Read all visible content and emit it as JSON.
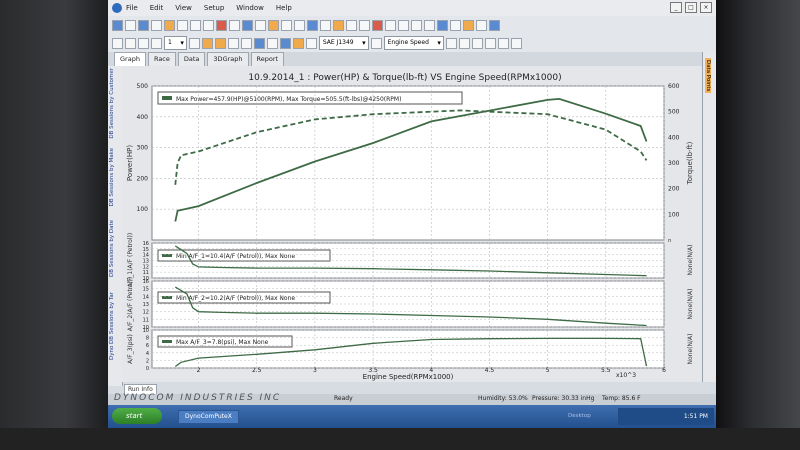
{
  "menu": {
    "items": [
      "File",
      "Edit",
      "View",
      "Setup",
      "Window",
      "Help"
    ]
  },
  "toolbar": {
    "zoom_value": "1",
    "standard": "SAE J1349",
    "xaxis": "Engine Speed"
  },
  "tabs": [
    "Graph",
    "Race",
    "Data",
    "3DGraph",
    "Report"
  ],
  "left_panel": [
    "DB Sessions by Customer",
    "DB Sessions by Make",
    "DB Sessions by Date",
    "Dyno DB Sessions by Tar"
  ],
  "right_panel": {
    "tab": "Data Points"
  },
  "chart": {
    "title": "10.9.2014_1 : Power(HP) & Torque(lb-ft) VS Engine Speed(RPMx1000)",
    "xlabel": "Engine Speed(RPMx1000)",
    "xscale_label": "x10^3",
    "xticks": [
      "2",
      "2.5",
      "3",
      "3.5",
      "4",
      "4.5",
      "5",
      "5.5",
      "6"
    ],
    "panel1": {
      "ylabel_left": "Power(HP)",
      "ylabel_right": "Torque(lb-ft)",
      "yticks_left": [
        "100",
        "200",
        "300",
        "400",
        "500"
      ],
      "yticks_right": [
        "100",
        "200",
        "300",
        "400",
        "500",
        "600"
      ],
      "legend": "Max Power=457.9(HP)@5100(RPM), Max Torque=505.5(ft-lbs)@4250(RPM)"
    },
    "panel2": {
      "ylabel_left": "A/F_1(A/F (Petrol))",
      "ylabel_right": "None(N/A)",
      "yticks_left": [
        "10",
        "11",
        "12",
        "13",
        "14",
        "15",
        "16"
      ],
      "right_tick": "n",
      "legend": "Min A/F_1=10.4(A/F (Petrol)), Max None"
    },
    "panel3": {
      "ylabel_left": "A/F_2(A/F (Petrol))",
      "ylabel_right": "None(N/A)",
      "yticks_left": [
        "10",
        "11",
        "12",
        "13",
        "14",
        "15",
        "16"
      ],
      "legend": "Min A/F_2=10.2(A/F (Petrol)), Max None"
    },
    "panel4": {
      "ylabel_left": "A/F_3(psi)",
      "ylabel_right": "None(N/A)",
      "yticks_left": [
        "0",
        "2",
        "4",
        "6",
        "8",
        "10"
      ],
      "legend": "Max A/F_3=7.8(psi), Max None"
    }
  },
  "chart_data": [
    {
      "type": "line",
      "title": "10.9.2014_1 : Power(HP) & Torque(lb-ft) VS Engine Speed(RPMx1000)",
      "xlabel": "Engine Speed(RPMx1000)",
      "ylabel": "Power(HP)",
      "ylabel_right": "Torque(lb-ft)",
      "xlim": [
        1.6,
        6
      ],
      "ylim": [
        0,
        500
      ],
      "ylim_right": [
        0,
        600
      ],
      "series": [
        {
          "name": "Power(HP)",
          "axis": "left",
          "x": [
            1.8,
            1.82,
            2,
            2.5,
            3,
            3.5,
            4,
            4.5,
            5,
            5.1,
            5.5,
            5.8,
            5.85
          ],
          "y": [
            60,
            95,
            110,
            185,
            255,
            315,
            385,
            420,
            455,
            458,
            410,
            370,
            320
          ]
        },
        {
          "name": "Torque(lb-ft)",
          "axis": "right",
          "style": "dashed",
          "x": [
            1.8,
            1.82,
            1.85,
            2,
            2.5,
            3,
            3.5,
            4,
            4.25,
            4.5,
            5,
            5.5,
            5.8,
            5.85
          ],
          "y": [
            215,
            300,
            330,
            345,
            420,
            470,
            490,
            500,
            505,
            500,
            490,
            430,
            345,
            310
          ]
        }
      ]
    },
    {
      "type": "line",
      "ylabel": "A/F_1(A/F (Petrol))",
      "xlim": [
        1.6,
        6
      ],
      "ylim": [
        10,
        16
      ],
      "series": [
        {
          "name": "A/F_1",
          "x": [
            1.8,
            1.9,
            1.95,
            2,
            2.2,
            2.5,
            3,
            3.5,
            4,
            4.5,
            5,
            5.5,
            5.85
          ],
          "y": [
            15.5,
            14.2,
            12.4,
            11.9,
            11.8,
            11.7,
            11.7,
            11.6,
            11.4,
            11.2,
            10.9,
            10.6,
            10.4
          ]
        }
      ]
    },
    {
      "type": "line",
      "ylabel": "A/F_2(A/F (Petrol))",
      "xlim": [
        1.6,
        6
      ],
      "ylim": [
        10,
        16
      ],
      "series": [
        {
          "name": "A/F_2",
          "x": [
            1.8,
            1.9,
            1.95,
            2,
            2.2,
            2.5,
            3,
            3.5,
            4,
            4.5,
            5,
            5.5,
            5.85
          ],
          "y": [
            15.2,
            14.3,
            12.5,
            12.0,
            11.9,
            11.8,
            11.8,
            11.7,
            11.5,
            11.3,
            11.0,
            10.5,
            10.2
          ]
        }
      ]
    },
    {
      "type": "line",
      "ylabel": "A/F_3(psi)",
      "xlim": [
        1.6,
        6
      ],
      "ylim": [
        0,
        10
      ],
      "series": [
        {
          "name": "A/F_3",
          "x": [
            1.8,
            1.85,
            2,
            2.5,
            3,
            3.5,
            4,
            4.5,
            5,
            5.5,
            5.8,
            5.85
          ],
          "y": [
            0.4,
            1.5,
            2.6,
            3.6,
            4.8,
            6.5,
            7.5,
            7.7,
            7.8,
            7.8,
            7.7,
            0.5
          ]
        }
      ]
    }
  ],
  "run_info": "Run Info",
  "status": {
    "brand": "DYNOCOM INDUSTRIES INC",
    "ready": "Ready",
    "humidity": "Humidity: 53.0%",
    "pressure": "Pressure: 30.33 inHg",
    "temp": "Temp: 85.6 F"
  },
  "taskbar": {
    "start": "start",
    "task": "DynoComPuteX",
    "desktop": "Desktop",
    "clock": "1:51 PM"
  },
  "colors": {
    "series": "#3e6b45",
    "panel_bg": "#ffffff",
    "grid": "#b9bcc0"
  }
}
